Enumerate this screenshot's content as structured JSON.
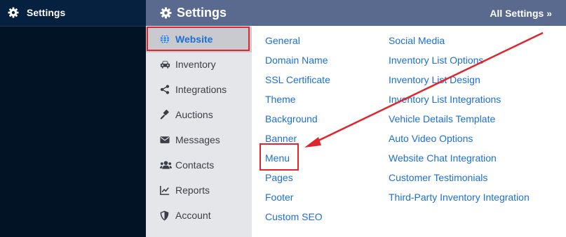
{
  "nav": {
    "title": "Settings",
    "icon": "gear-icon"
  },
  "header": {
    "title": "Settings",
    "all_settings": "All Settings »"
  },
  "sidebar": {
    "items": [
      {
        "label": "Website",
        "icon": "globe-icon",
        "active": true
      },
      {
        "label": "Inventory",
        "icon": "car-icon"
      },
      {
        "label": "Integrations",
        "icon": "share-icon"
      },
      {
        "label": "Auctions",
        "icon": "gavel-icon"
      },
      {
        "label": "Messages",
        "icon": "envelope-icon"
      },
      {
        "label": "Contacts",
        "icon": "users-icon"
      },
      {
        "label": "Reports",
        "icon": "chart-line-icon"
      },
      {
        "label": "Account",
        "icon": "shield-icon"
      }
    ]
  },
  "links": {
    "col1": [
      "General",
      "Domain Name",
      "SSL Certificate",
      "Theme",
      "Background",
      "Banner",
      "Menu",
      "Pages",
      "Footer",
      "Custom SEO"
    ],
    "col2": [
      "Social Media",
      "Inventory List Options",
      "Inventory List Design",
      "Inventory List Integrations",
      "Vehicle Details Template",
      "Auto Video Options",
      "Website Chat Integration",
      "Customer Testimonials",
      "Third-Party Inventory Integration"
    ]
  },
  "colors": {
    "accent": "#1b6fd6",
    "highlight": "#e0252c",
    "header": "#5a6a8f",
    "nav": "#021325"
  }
}
